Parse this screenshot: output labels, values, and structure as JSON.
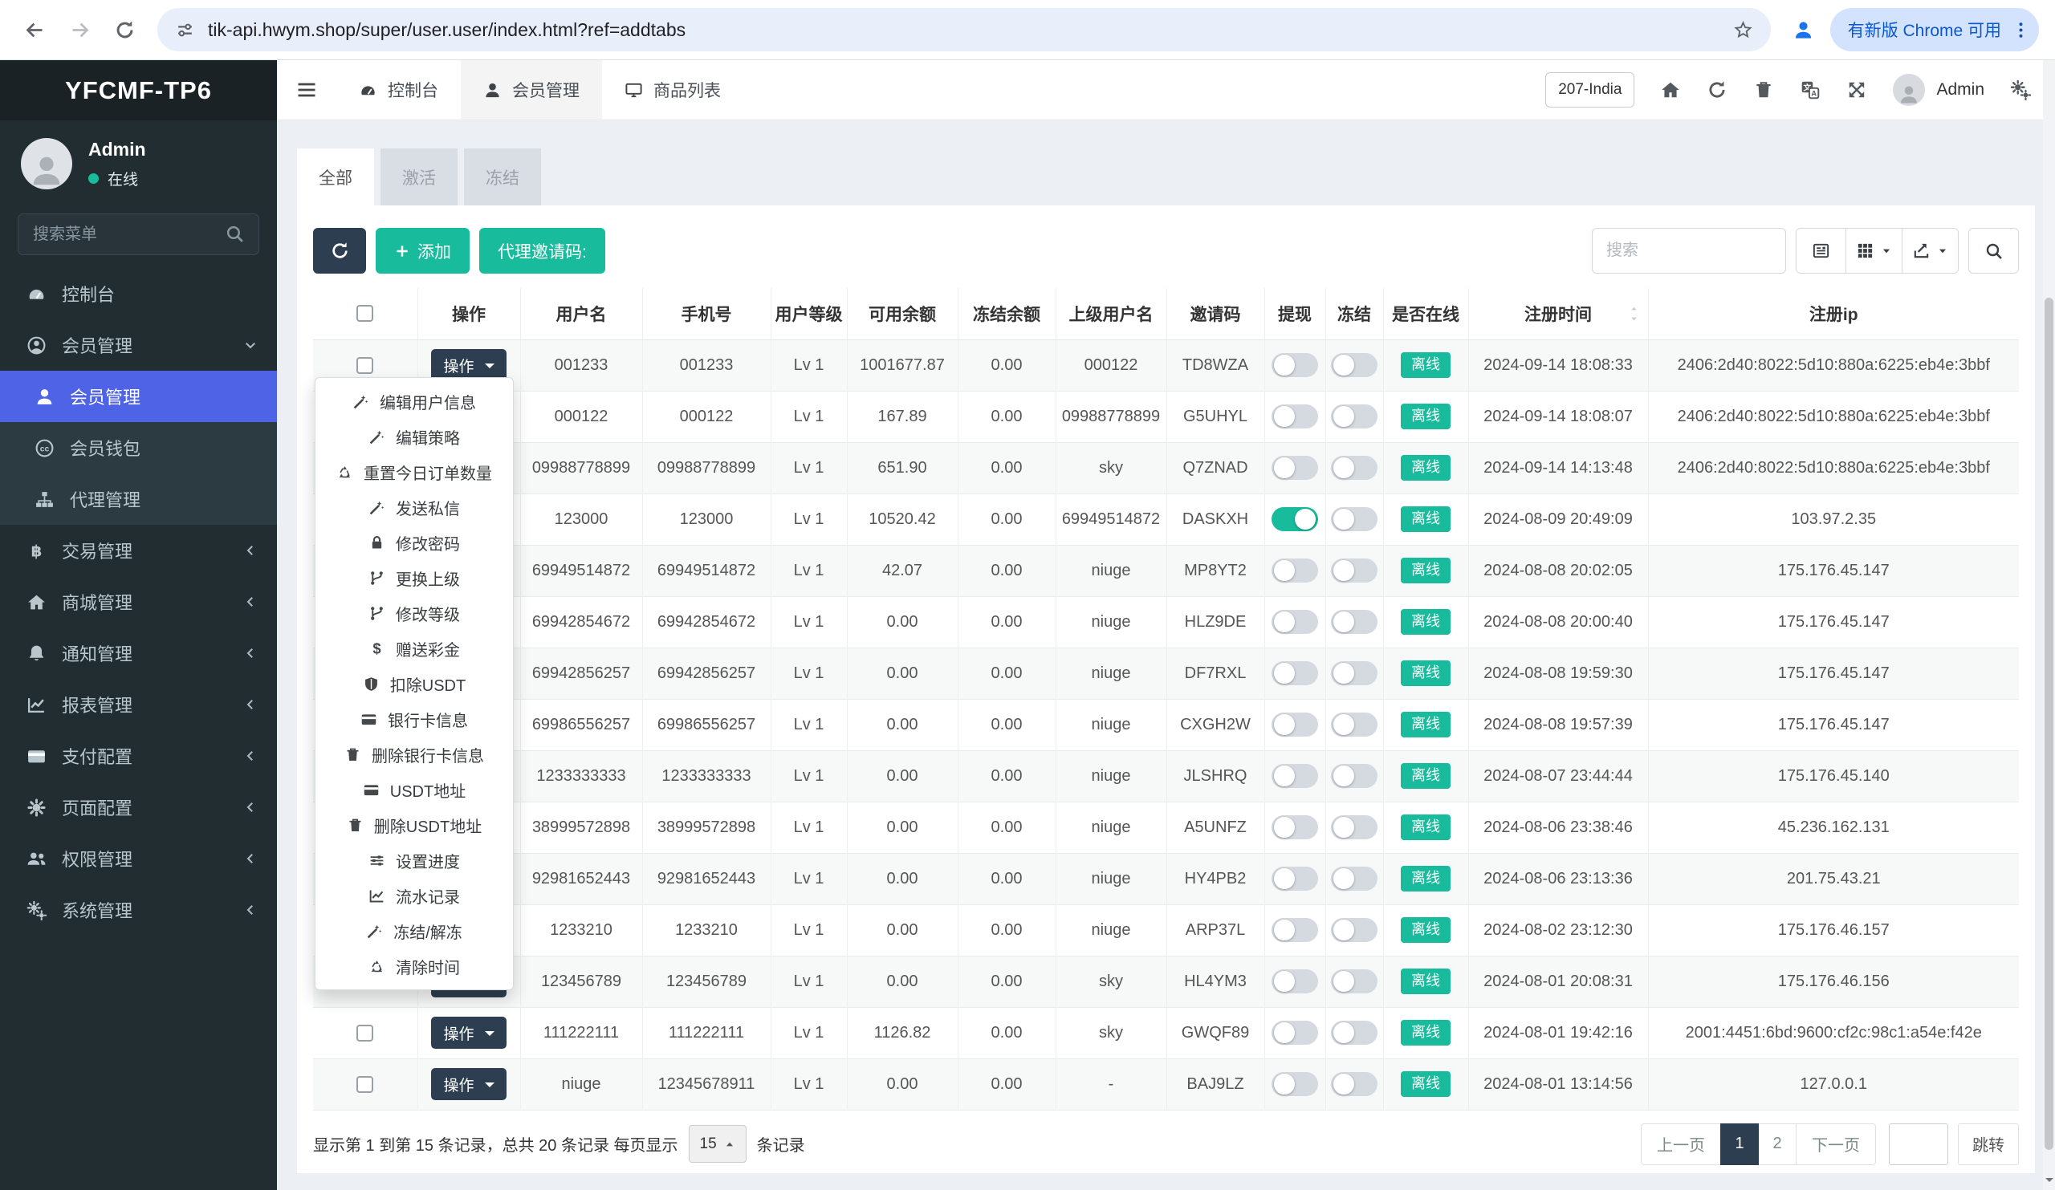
{
  "browser": {
    "url": "tik-api.hwym.shop/super/user.user/index.html?ref=addtabs",
    "update_button": "有新版 Chrome 可用"
  },
  "sidebar": {
    "logo": "YFCMF-TP6",
    "user_name": "Admin",
    "user_status": "在线",
    "search_placeholder": "搜索菜单",
    "menu": [
      {
        "icon": "gauge",
        "label": "控制台"
      },
      {
        "icon": "user-circle",
        "label": "会员管理",
        "chevron": "down"
      },
      {
        "icon": "user",
        "label": "会员管理",
        "sub": true,
        "active": true
      },
      {
        "icon": "wallet",
        "label": "会员钱包",
        "sub": true
      },
      {
        "icon": "sitemap",
        "label": "代理管理",
        "sub": true
      },
      {
        "icon": "baht",
        "label": "交易管理",
        "chevron": "left"
      },
      {
        "icon": "home",
        "label": "商城管理",
        "chevron": "left"
      },
      {
        "icon": "bell",
        "label": "通知管理",
        "chevron": "left"
      },
      {
        "icon": "chart",
        "label": "报表管理",
        "chevron": "left"
      },
      {
        "icon": "card",
        "label": "支付配置",
        "chevron": "left"
      },
      {
        "icon": "gear",
        "label": "页面配置",
        "chevron": "left"
      },
      {
        "icon": "users",
        "label": "权限管理",
        "chevron": "left"
      },
      {
        "icon": "gears",
        "label": "系统管理",
        "chevron": "left"
      }
    ]
  },
  "navbar": {
    "tabs": [
      {
        "icon": "gauge",
        "label": "控制台"
      },
      {
        "icon": "user",
        "label": "会员管理",
        "active": true
      },
      {
        "icon": "desktop",
        "label": "商品列表"
      }
    ],
    "env_label": "207-India",
    "user_name": "Admin"
  },
  "page": {
    "tabs": [
      {
        "label": "全部",
        "active": true
      },
      {
        "label": "激活"
      },
      {
        "label": "冻结"
      }
    ],
    "add_label": "添加",
    "invite_label": "代理邀请码:",
    "search_placeholder": "搜索"
  },
  "table": {
    "op_label": "操作",
    "columns": [
      "",
      "操作",
      "用户名",
      "手机号",
      "用户等级",
      "可用余额",
      "冻结余额",
      "上级用户名",
      "邀请码",
      "提现",
      "冻结",
      "是否在线",
      "注册时间",
      "注册ip"
    ],
    "rows": [
      {
        "username": "001233",
        "phone": "001233",
        "level": "Lv 1",
        "balance": "1001677.87",
        "frozen": "0.00",
        "parent": "000122",
        "invite": "TD8WZA",
        "withdraw": false,
        "freeze": false,
        "online": "离线",
        "time": "2024-09-14 18:08:33",
        "ip": "2406:2d40:8022:5d10:880a:6225:eb4e:3bbf"
      },
      {
        "username": "000122",
        "phone": "000122",
        "level": "Lv 1",
        "balance": "167.89",
        "frozen": "0.00",
        "parent": "09988778899",
        "invite": "G5UHYL",
        "withdraw": false,
        "freeze": false,
        "online": "离线",
        "time": "2024-09-14 18:08:07",
        "ip": "2406:2d40:8022:5d10:880a:6225:eb4e:3bbf"
      },
      {
        "username": "09988778899",
        "phone": "09988778899",
        "level": "Lv 1",
        "balance": "651.90",
        "frozen": "0.00",
        "parent": "sky",
        "invite": "Q7ZNAD",
        "withdraw": false,
        "freeze": false,
        "online": "离线",
        "time": "2024-09-14 14:13:48",
        "ip": "2406:2d40:8022:5d10:880a:6225:eb4e:3bbf"
      },
      {
        "username": "123000",
        "phone": "123000",
        "level": "Lv 1",
        "balance": "10520.42",
        "frozen": "0.00",
        "parent": "69949514872",
        "invite": "DASKXH",
        "withdraw": true,
        "freeze": false,
        "online": "离线",
        "time": "2024-08-09 20:49:09",
        "ip": "103.97.2.35"
      },
      {
        "username": "69949514872",
        "phone": "69949514872",
        "level": "Lv 1",
        "balance": "42.07",
        "frozen": "0.00",
        "parent": "niuge",
        "invite": "MP8YT2",
        "withdraw": false,
        "freeze": false,
        "online": "离线",
        "time": "2024-08-08 20:02:05",
        "ip": "175.176.45.147"
      },
      {
        "username": "69942854672",
        "phone": "69942854672",
        "level": "Lv 1",
        "balance": "0.00",
        "frozen": "0.00",
        "parent": "niuge",
        "invite": "HLZ9DE",
        "withdraw": false,
        "freeze": false,
        "online": "离线",
        "time": "2024-08-08 20:00:40",
        "ip": "175.176.45.147"
      },
      {
        "username": "69942856257",
        "phone": "69942856257",
        "level": "Lv 1",
        "balance": "0.00",
        "frozen": "0.00",
        "parent": "niuge",
        "invite": "DF7RXL",
        "withdraw": false,
        "freeze": false,
        "online": "离线",
        "time": "2024-08-08 19:59:30",
        "ip": "175.176.45.147"
      },
      {
        "username": "69986556257",
        "phone": "69986556257",
        "level": "Lv 1",
        "balance": "0.00",
        "frozen": "0.00",
        "parent": "niuge",
        "invite": "CXGH2W",
        "withdraw": false,
        "freeze": false,
        "online": "离线",
        "time": "2024-08-08 19:57:39",
        "ip": "175.176.45.147"
      },
      {
        "username": "1233333333",
        "phone": "1233333333",
        "level": "Lv 1",
        "balance": "0.00",
        "frozen": "0.00",
        "parent": "niuge",
        "invite": "JLSHRQ",
        "withdraw": false,
        "freeze": false,
        "online": "离线",
        "time": "2024-08-07 23:44:44",
        "ip": "175.176.45.140"
      },
      {
        "username": "38999572898",
        "phone": "38999572898",
        "level": "Lv 1",
        "balance": "0.00",
        "frozen": "0.00",
        "parent": "niuge",
        "invite": "A5UNFZ",
        "withdraw": false,
        "freeze": false,
        "online": "离线",
        "time": "2024-08-06 23:38:46",
        "ip": "45.236.162.131"
      },
      {
        "username": "92981652443",
        "phone": "92981652443",
        "level": "Lv 1",
        "balance": "0.00",
        "frozen": "0.00",
        "parent": "niuge",
        "invite": "HY4PB2",
        "withdraw": false,
        "freeze": false,
        "online": "离线",
        "time": "2024-08-06 23:13:36",
        "ip": "201.75.43.21"
      },
      {
        "username": "1233210",
        "phone": "1233210",
        "level": "Lv 1",
        "balance": "0.00",
        "frozen": "0.00",
        "parent": "niuge",
        "invite": "ARP37L",
        "withdraw": false,
        "freeze": false,
        "online": "离线",
        "time": "2024-08-02 23:12:30",
        "ip": "175.176.46.157"
      },
      {
        "username": "123456789",
        "phone": "123456789",
        "level": "Lv 1",
        "balance": "0.00",
        "frozen": "0.00",
        "parent": "sky",
        "invite": "HL4YM3",
        "withdraw": false,
        "freeze": false,
        "online": "离线",
        "time": "2024-08-01 20:08:31",
        "ip": "175.176.46.156"
      },
      {
        "username": "111222111",
        "phone": "111222111",
        "level": "Lv 1",
        "balance": "1126.82",
        "frozen": "0.00",
        "parent": "sky",
        "invite": "GWQF89",
        "withdraw": false,
        "freeze": false,
        "online": "离线",
        "time": "2024-08-01 19:42:16",
        "ip": "2001:4451:6bd:9600:cf2c:98c1:a54e:f42e"
      },
      {
        "username": "niuge",
        "phone": "12345678911",
        "level": "Lv 1",
        "balance": "0.00",
        "frozen": "0.00",
        "parent": "-",
        "invite": "BAJ9LZ",
        "withdraw": false,
        "freeze": false,
        "online": "离线",
        "time": "2024-08-01 13:14:56",
        "ip": "127.0.0.1"
      }
    ]
  },
  "dropdown": {
    "items": [
      {
        "icon": "wand",
        "label": "编辑用户信息"
      },
      {
        "icon": "wand",
        "label": "编辑策略"
      },
      {
        "icon": "recycle",
        "label": "重置今日订单数量"
      },
      {
        "icon": "wand",
        "label": "发送私信"
      },
      {
        "icon": "lock",
        "label": "修改密码"
      },
      {
        "icon": "branch",
        "label": "更换上级"
      },
      {
        "icon": "branch",
        "label": "修改等级"
      },
      {
        "icon": "dollar",
        "label": "赠送彩金"
      },
      {
        "icon": "shield",
        "label": "扣除USDT"
      },
      {
        "icon": "card",
        "label": "银行卡信息"
      },
      {
        "icon": "trash",
        "label": "删除银行卡信息"
      },
      {
        "icon": "card",
        "label": "USDT地址"
      },
      {
        "icon": "trash",
        "label": "删除USDT地址"
      },
      {
        "icon": "sliders",
        "label": "设置进度"
      },
      {
        "icon": "chart",
        "label": "流水记录"
      },
      {
        "icon": "wand",
        "label": "冻结/解冻"
      },
      {
        "icon": "recycle",
        "label": "清除时间"
      }
    ]
  },
  "pagination": {
    "summary_prefix": "显示第 1 到第 15 条记录，总共 20 条记录 每页显示",
    "page_size": "15",
    "summary_suffix": "条记录",
    "prev": "上一页",
    "pages": [
      "1",
      "2"
    ],
    "active_page": "1",
    "next": "下一页",
    "jump": "跳转"
  },
  "colors": {
    "green": "#18bc9c",
    "dark": "#2c3e50",
    "sidebar_active_blue": "#4f63e6",
    "badge_online": "#18bc9c"
  }
}
